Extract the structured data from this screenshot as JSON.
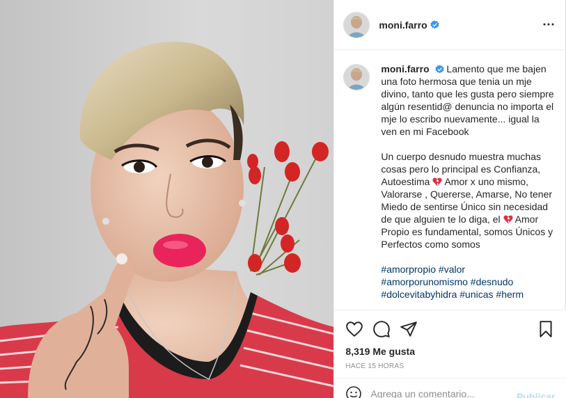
{
  "post": {
    "author": "moni.farro",
    "caption_paragraphs": [
      "Lamento que me bajen una foto hermosa que tenia un mje divino, tanto que les gusta pero siempre algún resentid@ denuncia no importa el mje lo escribo nuevamente... igual la ven en mi Facebook",
      "Un cuerpo desnudo muestra muchas cosas pero lo principal es Confianza, Autoestima ",
      " Amor x uno mismo, Valorarse , Quererse, Amarse, No tener Miedo de sentirse Único sin necesidad de que alguien te lo diga, el ",
      "  Amor Propio es fundamental, somos Únicos y Perfectos como somos"
    ],
    "hashtags": [
      "#amorpropio",
      "#valor",
      "#amorporunomismo",
      "#desnudo",
      "#dolcevitabyhidra",
      "#unicas",
      "#herm"
    ],
    "likes_text": "8,319 Me gusta",
    "timestamp": "HACE 15 HORAS"
  },
  "comment": {
    "placeholder": "Agrega un comentario...",
    "publish_label": "Publicar"
  },
  "icons": {
    "like": "heart-icon",
    "comment": "comment-icon",
    "share": "share-icon",
    "save": "bookmark-icon",
    "more": "more-icon",
    "verified": "verified-badge-icon",
    "emoji": "emoji-icon"
  },
  "colors": {
    "verified": "#3897f0",
    "link": "#00376b",
    "publish_disabled": "#b2dffc",
    "muted": "#8e8e8e"
  }
}
